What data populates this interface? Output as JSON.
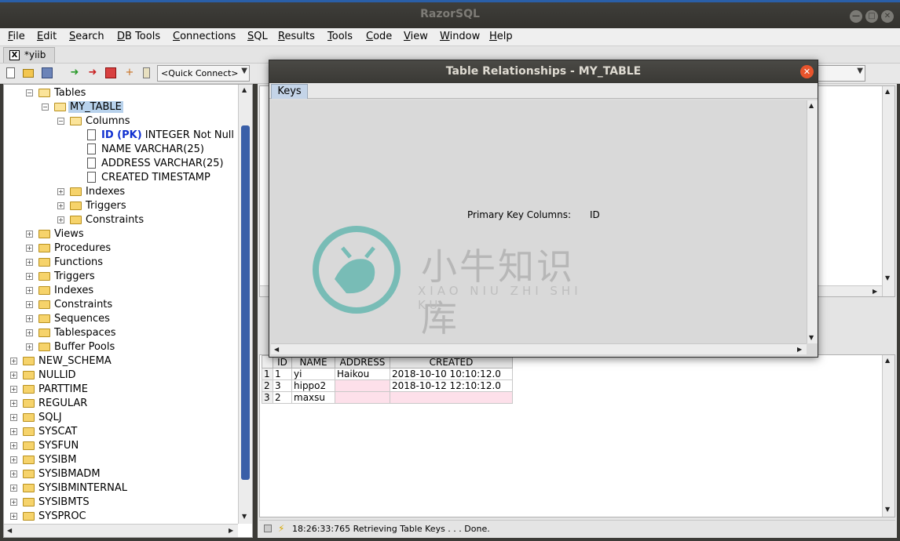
{
  "window": {
    "title": "RazorSQL",
    "btn_min": "—",
    "btn_max": "□",
    "btn_close": "✕"
  },
  "menu": [
    "File",
    "Edit",
    "Search",
    "DB Tools",
    "Connections",
    "SQL",
    "Results",
    "Tools",
    "Code",
    "View",
    "Window",
    "Help"
  ],
  "tab": {
    "close": "X",
    "label": "*yiib"
  },
  "toolbar": {
    "quick_connect": "<Quick Connect>",
    "combo_arrow": "▼"
  },
  "tree": {
    "tables": "Tables",
    "my_table": "MY_TABLE",
    "columns": "Columns",
    "col_id_pk": "ID (PK)",
    "col_id_rest": " INTEGER Not Null",
    "col_name": "NAME VARCHAR(25)",
    "col_address": "ADDRESS VARCHAR(25)",
    "col_created": "CREATED TIMESTAMP",
    "indexes": "Indexes",
    "triggers": "Triggers",
    "constraints": "Constraints",
    "schema_items": [
      "Views",
      "Procedures",
      "Functions",
      "Triggers",
      "Indexes",
      "Constraints",
      "Sequences",
      "Tablespaces",
      "Buffer Pools"
    ],
    "schemas": [
      "NEW_SCHEMA",
      "NULLID",
      "PARTTIME",
      "REGULAR",
      "SQLJ",
      "SYSCAT",
      "SYSFUN",
      "SYSIBM",
      "SYSIBMADM",
      "SYSIBMINTERNAL",
      "SYSIBMTS",
      "SYSPROC"
    ]
  },
  "results": {
    "headers": [
      "ID",
      "NAME",
      "ADDRESS",
      "CREATED"
    ],
    "rows": [
      {
        "num": "1",
        "id": "1",
        "name": "yi",
        "address": "Haikou",
        "created": "2018-10-10 10:10:12.0"
      },
      {
        "num": "2",
        "id": "3",
        "name": "hippo2",
        "address": "",
        "created": "2018-10-12 12:10:12.0"
      },
      {
        "num": "3",
        "id": "2",
        "name": "maxsu",
        "address": "",
        "created": ""
      }
    ]
  },
  "status": {
    "text": "18:26:33:765 Retrieving Table Keys . . . Done."
  },
  "dialog": {
    "title": "Table Relationships - MY_TABLE",
    "close": "✕",
    "tab": "Keys",
    "pk_label": "Primary Key Columns:",
    "pk_value": "ID"
  },
  "watermark": {
    "chinese": "小牛知识库",
    "pinyin": "XIAO NIU ZHI SHI KU"
  }
}
